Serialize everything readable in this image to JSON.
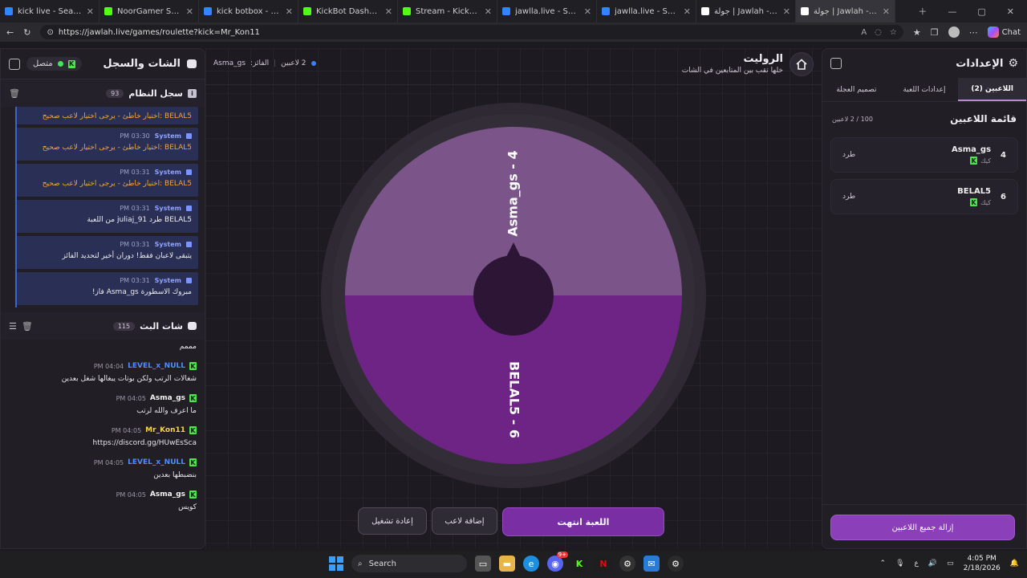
{
  "browser": {
    "tabs": [
      {
        "title": "kick live - Search",
        "color": "#2f86ff"
      },
      {
        "title": "NoorGamer Stream - Wo",
        "color": "#53fc18"
      },
      {
        "title": "kick botbox - Search",
        "color": "#2f86ff"
      },
      {
        "title": "KickBot Dashboard",
        "color": "#53fc18"
      },
      {
        "title": "Stream - Kick Dashboard",
        "color": "#53fc18"
      },
      {
        "title": "jawlla.live - Search",
        "color": "#2f86ff"
      },
      {
        "title": "jawlla.live - Search Imag",
        "color": "#2f86ff"
      },
      {
        "title": "جولة | Jawlah - منصة الأ",
        "color": "#ffffff"
      },
      {
        "title": "جولة | Jawlah - منصة الأ",
        "color": "#ffffff"
      }
    ],
    "url": "https://jawlah.live/games/roulette?kick=Mr_Kon11",
    "copilot_label": "Chat"
  },
  "chat_panel": {
    "title": "الشات والسجل",
    "status": "متصل",
    "system_log": {
      "title": "سجل النظام",
      "count": "93",
      "items": [
        {
          "sender": "",
          "time": "",
          "text": "BELAL5 :اختيار خاطئ - يرجى اختيار لاعب صحيح",
          "warn": true
        },
        {
          "sender": "System",
          "time": "PM 03:30",
          "text": "BELAL5 :اختيار خاطئ - يرجى اختيار لاعب صحيح",
          "warn": true
        },
        {
          "sender": "System",
          "time": "PM 03:31",
          "text": "BELAL5 :اختيار خاطئ - يرجى اختيار لاعب صحيح",
          "warn": true
        },
        {
          "sender": "System",
          "time": "PM 03:31",
          "text": "BELAL5 طرد juliaj_91 من اللعبة",
          "warn": false
        },
        {
          "sender": "System",
          "time": "PM 03:31",
          "text": "يتبقى لاعبان فقط! دوران أخير لتحديد الفائز",
          "warn": false
        },
        {
          "sender": "System",
          "time": "PM 03:31",
          "text": "مبروك الاسطورة Asma_gs فاز!",
          "warn": false
        }
      ]
    },
    "stream_chat": {
      "title": "شات البث",
      "count": "115",
      "first_line": "مممم",
      "messages": [
        {
          "user": "LEVEL_x_NULL",
          "time": "PM 04:04",
          "text": "شغالات الرتب ولكن بوتات يبغالها شغل بعدين",
          "color": "#4f8cff"
        },
        {
          "user": "Asma_gs",
          "time": "PM 04:05",
          "text": "ما اعرف والله لرتب",
          "color": "#f2f2f2"
        },
        {
          "user": "Mr_Kon11",
          "time": "PM 04:05",
          "text": "https://discord.gg/HUwEsSca",
          "color": "#f5d44a"
        },
        {
          "user": "LEVEL_x_NULL",
          "time": "PM 04:05",
          "text": "بنضبطها بعدين",
          "color": "#4f8cff"
        },
        {
          "user": "Asma_gs",
          "time": "PM 04:05",
          "text": "كويس",
          "color": "#f2f2f2"
        }
      ]
    }
  },
  "game": {
    "title": "الروليت",
    "subtitle": "خلها تقب بين المتابعين في الشات",
    "players_stat": "2 لاعبين",
    "winner_label": "الفائز:",
    "winner_name": "Asma_gs",
    "wheel": {
      "segments": [
        {
          "label": "Asma_gs - 4",
          "color": "#7b5489"
        },
        {
          "label": "BELAL5 - 6",
          "color": "#6e2484"
        }
      ]
    },
    "buttons": {
      "game_over": "اللعبة انتهت",
      "add_player": "إضافة لاعب",
      "restart": "إعادة تشغيل"
    }
  },
  "settings": {
    "title": "الإعدادات",
    "tabs": [
      "اللاعبين (2)",
      "إعدادات اللعبة",
      "تصميم العجلة"
    ],
    "list_title": "قائمة اللاعبين",
    "list_count": "100 / 2 لاعبين",
    "players": [
      {
        "num": "4",
        "name": "Asma_gs",
        "platform": "كيك",
        "action": "طرد"
      },
      {
        "num": "6",
        "name": "BELAL5",
        "platform": "كيك",
        "action": "طرد"
      }
    ],
    "remove_all": "إزالة جميع اللاعبين"
  },
  "taskbar": {
    "search_placeholder": "Search",
    "discord_badge": "9+",
    "lang": "ع",
    "time": "4:05 PM",
    "date": "2/18/2026"
  }
}
